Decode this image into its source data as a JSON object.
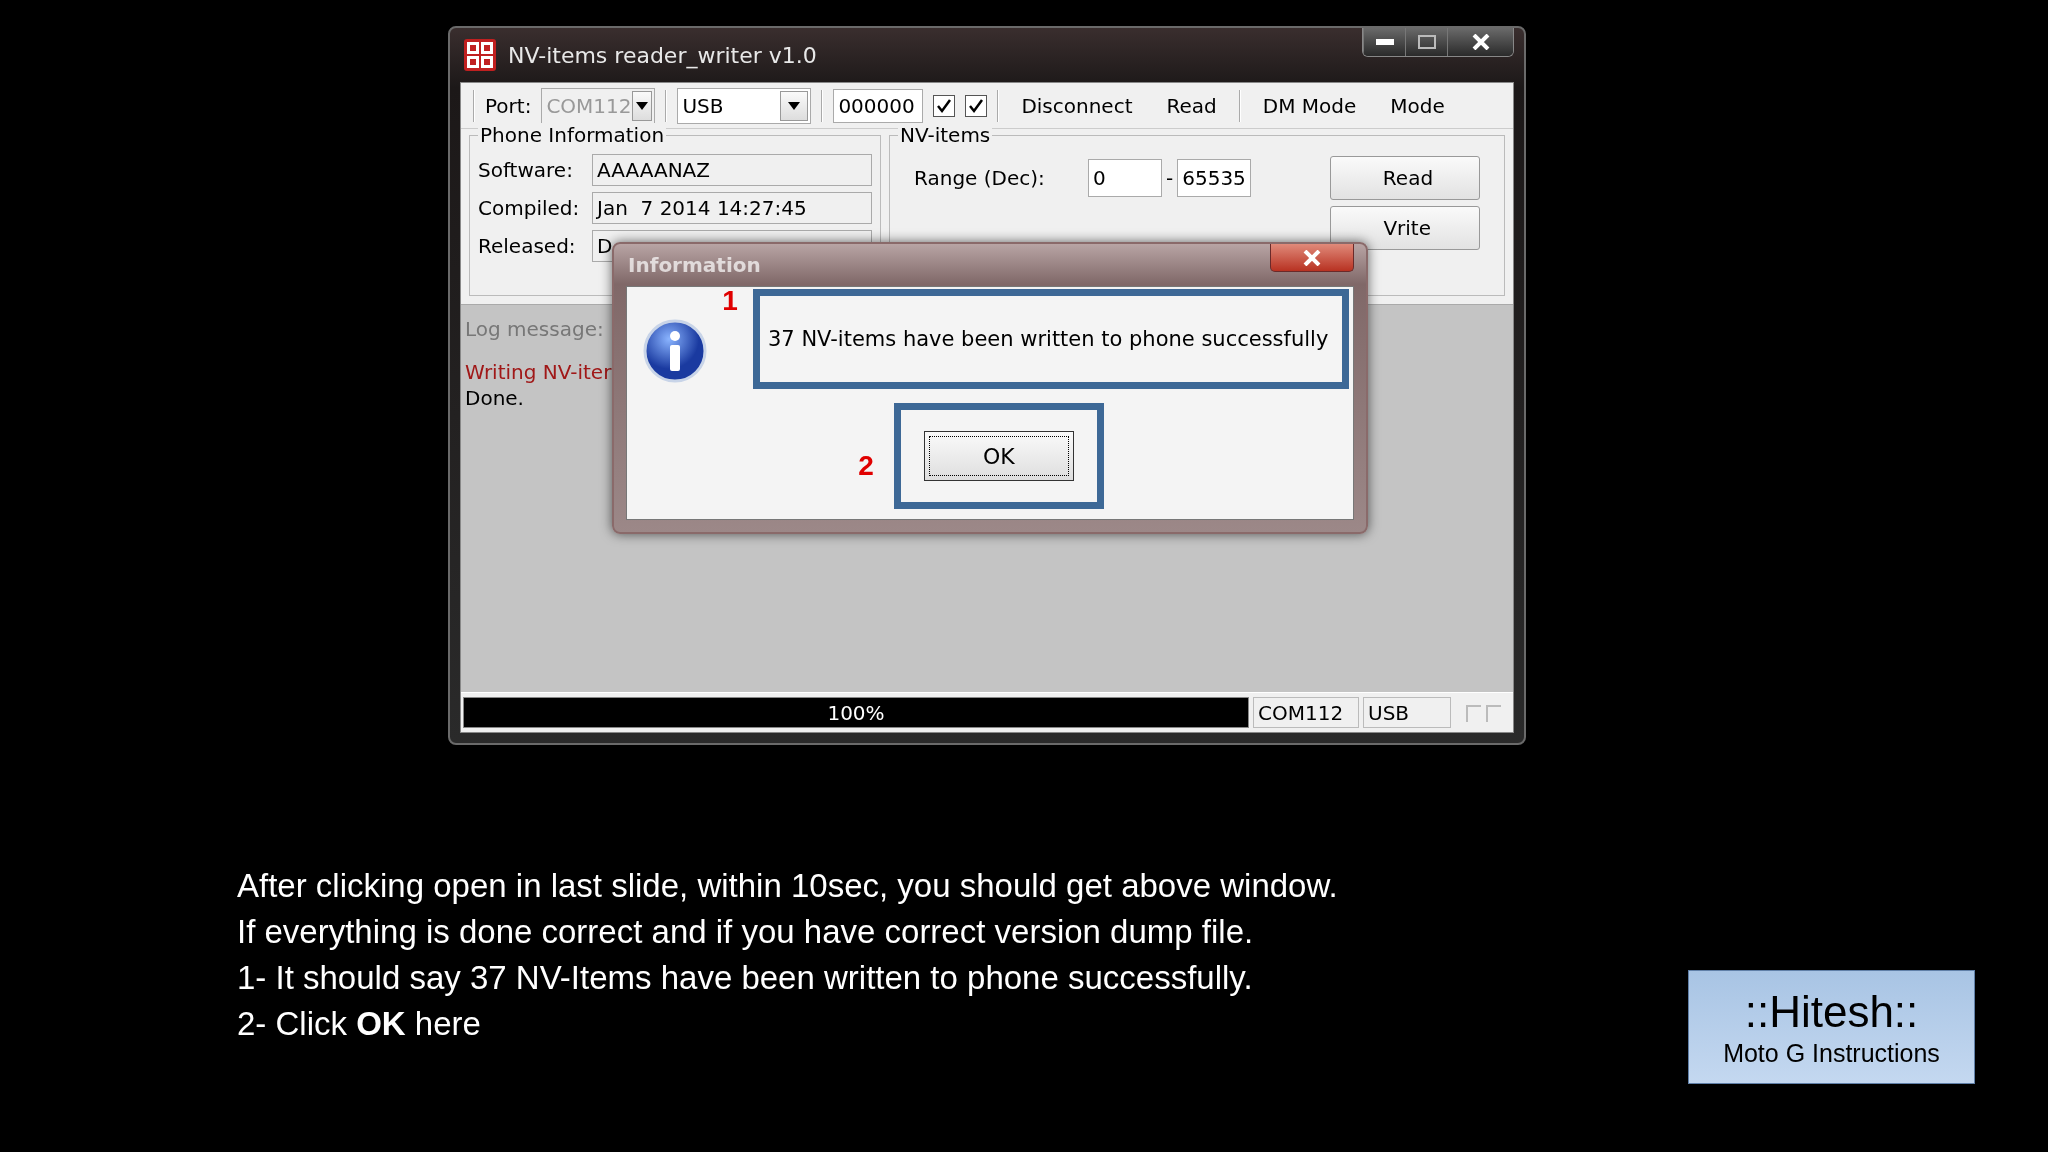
{
  "window": {
    "title": "NV-items reader_writer v1.0"
  },
  "toolbar": {
    "port_label": "Port:",
    "port": {
      "value": "COM112",
      "disabled": true
    },
    "connection": {
      "value": "USB",
      "disabled": false
    },
    "code": "000000",
    "checkboxes": [
      {
        "checked": true
      },
      {
        "checked": true
      }
    ],
    "buttons": [
      "Disconnect",
      "Read",
      "DM Mode",
      "Mode"
    ]
  },
  "phone_information": {
    "title": "Phone Information",
    "fields": [
      {
        "label": "Software:",
        "value": "AAAAANAZ"
      },
      {
        "label": "Compiled:",
        "value": "Jan  7 2014 14:27:45"
      },
      {
        "label": "Released:",
        "value": "D"
      }
    ]
  },
  "nv_items": {
    "title": "NV-items",
    "range_label": "Range (Dec):",
    "range_from": "0",
    "range_separator": "-",
    "range_to": "65535",
    "buttons": [
      "Read",
      "Vrite"
    ]
  },
  "log": {
    "title": "Log message:",
    "lines": [
      {
        "text": "Writing NV-iter",
        "kind": "error"
      },
      {
        "text": "Done.",
        "kind": "info"
      }
    ]
  },
  "status_bar": {
    "progress": {
      "level": 1,
      "reading": "100%"
    },
    "port": "COM112",
    "connection": "USB"
  },
  "dialog": {
    "title": "Information",
    "message": "37 NV-items have been written to phone successfully",
    "button": "OK",
    "markers": [
      "1",
      "2"
    ]
  },
  "slide": {
    "paragraphs": [
      "After clicking open in last slide, within 10sec, you should get above window.",
      "If everything is done correct and if you have correct version dump file.",
      "1- It should say 37 NV-Items have been written to phone successfully.",
      "2- Click **OK** here"
    ],
    "badge": {
      "title": "::Hitesh::",
      "subtitle": "Moto G Instructions"
    }
  }
}
